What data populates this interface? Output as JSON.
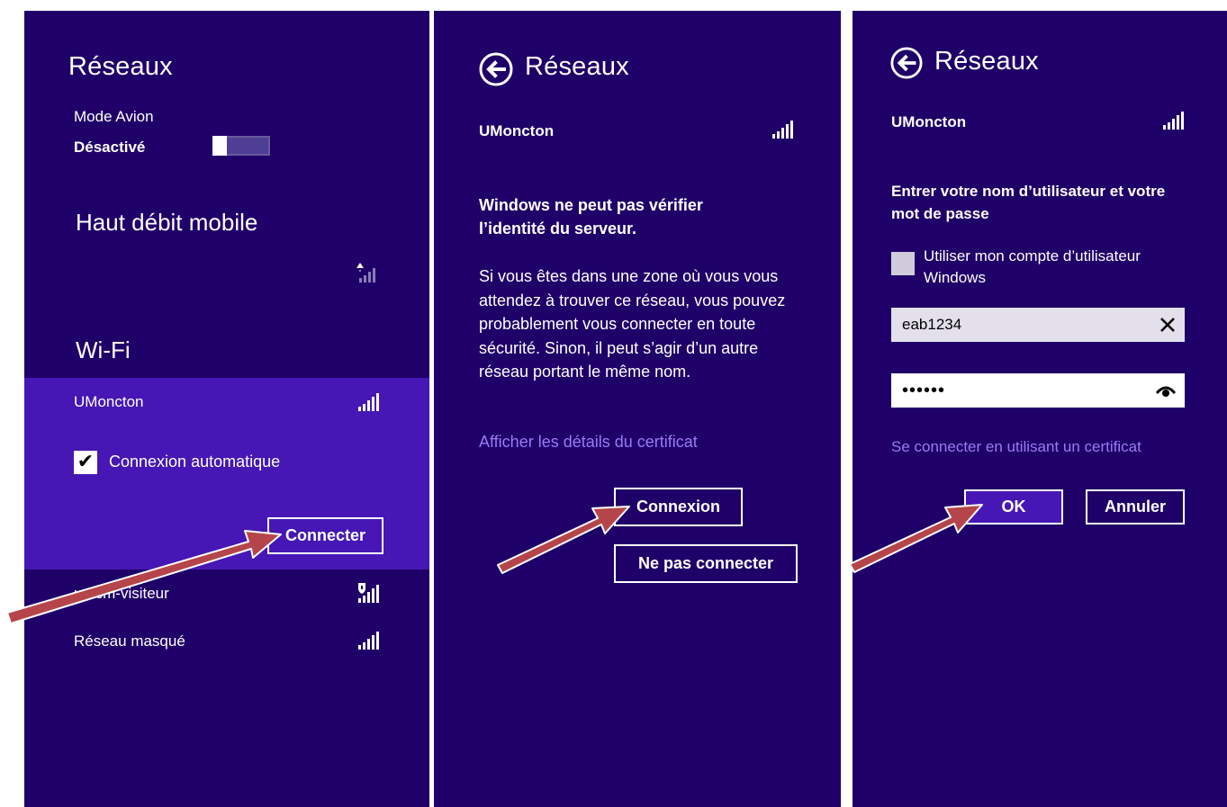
{
  "panel1": {
    "title": "Réseaux",
    "airplane_label": "Mode Avion",
    "airplane_state": "Désactivé",
    "mobile_section": "Haut débit mobile",
    "wifi_section": "Wi-Fi",
    "network_selected": "UMoncton",
    "auto_connect_label": "Connexion automatique",
    "connect_button": "Connecter",
    "network_2": "umcm-visiteur",
    "network_3": "Réseau masqué"
  },
  "panel2": {
    "title": "Réseaux",
    "network": "UMoncton",
    "warning_title": "Windows ne peut pas vérifier l’identité du serveur.",
    "warning_body": "Si vous êtes dans une zone où vous vous attendez à trouver ce réseau, vous pouvez probablement vous connecter en toute sécurité. Sinon, il peut s’agir d’un autre réseau portant le même nom.",
    "cert_link": "Afficher les détails du certificat",
    "connect_button": "Connexion",
    "dont_connect_button": "Ne pas connecter"
  },
  "panel3": {
    "title": "Réseaux",
    "network": "UMoncton",
    "prompt": "Entrer votre nom d’utilisateur et votre mot de passe",
    "use_account_label": "Utiliser mon compte d’utilisateur Windows",
    "username_value": "eab1234",
    "password_value": "••••••",
    "cert_link": "Se connecter en utilisant un certificat",
    "ok_button": "OK",
    "cancel_button": "Annuler"
  },
  "colors": {
    "background": "#1f0068",
    "selected_row": "#4617b4",
    "link": "#9a7af4",
    "arrow": "#b5454a"
  },
  "icons": [
    "wifi-signal-icon",
    "mobile-signal-icon",
    "shield-wifi-icon",
    "back-arrow-icon",
    "checkmark-icon",
    "clear-icon",
    "reveal-password-icon"
  ]
}
